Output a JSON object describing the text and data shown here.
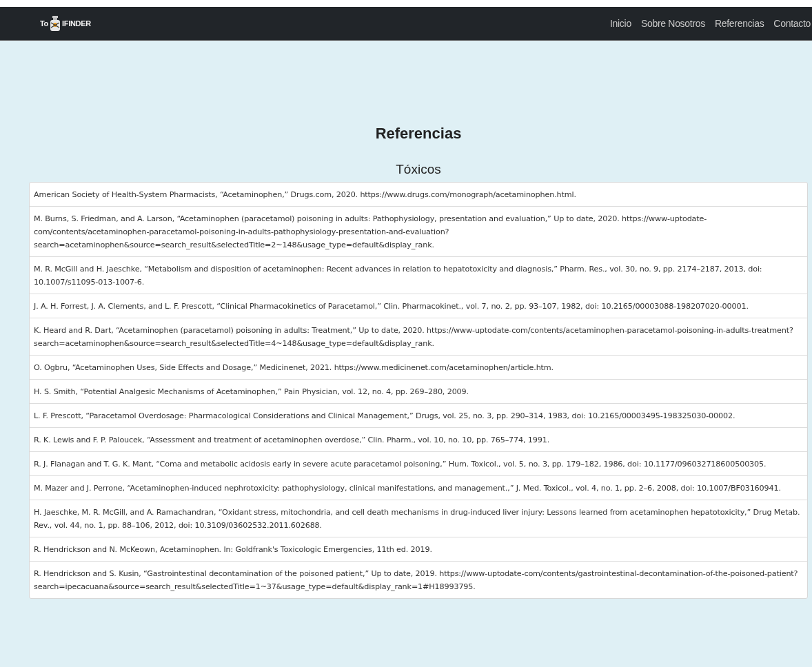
{
  "navbar": {
    "logo": {
      "prefix": "To",
      "suffix": "IFINDER"
    },
    "links": [
      {
        "label": "Inicio",
        "selected": false
      },
      {
        "label": "Sobre Nosotros",
        "selected": false
      },
      {
        "label": "Referencias",
        "selected": false
      },
      {
        "label": "Contacto",
        "selected": false
      }
    ]
  },
  "page_title": "Referencias",
  "section_title": "Tóxicos",
  "references": [
    "American Society of Health-System Pharmacists, “Acetaminophen,” Drugs.com, 2020. https://www.drugs.com/monograph/acetaminophen.html.",
    "M. Burns, S. Friedman, and A. Larson, “Acetaminophen (paracetamol) poisoning in adults: Pathophysiology, presentation and evaluation,” Up to date, 2020. https://www-uptodate-com/contents/acetaminophen-paracetamol-poisoning-in-adults-pathophysiology-presentation-and-evaluation?search=acetaminophen&source=search_result&selectedTitle=2~148&usage_type=default&display_rank.",
    "M. R. McGill and H. Jaeschke, “Metabolism and disposition of acetaminophen: Recent advances in relation to hepatotoxicity and diagnosis,” Pharm. Res., vol. 30, no. 9, pp. 2174–2187, 2013, doi: 10.1007/s11095-013-1007-6.",
    "J. A. H. Forrest, J. A. Clements, and L. F. Prescott, “Clinical Pharmacokinetics of Paracetamol,” Clin. Pharmacokinet., vol. 7, no. 2, pp. 93–107, 1982, doi: 10.2165/00003088-198207020-00001.",
    "K. Heard and R. Dart, “Acetaminophen (paracetamol) poisoning in adults: Treatment,” Up to date, 2020. https://www-uptodate-com/contents/acetaminophen-paracetamol-poisoning-in-adults-treatment?search=acetaminophen&source=search_result&selectedTitle=4~148&usage_type=default&display_rank.",
    "O. Ogbru, “Acetaminophen Uses, Side Effects and Dosage,” Medicinenet, 2021. https://www.medicinenet.com/acetaminophen/article.htm.",
    "H. S. Smith, “Potential Analgesic Mechanisms of Acetaminophen,” Pain Physician, vol. 12, no. 4, pp. 269–280, 2009.",
    "L. F. Prescott, “Paracetamol Overdosage: Pharmacological Considerations and Clinical Management,” Drugs, vol. 25, no. 3, pp. 290–314, 1983, doi: 10.2165/00003495-198325030-00002.",
    "R. K. Lewis and F. P. Paloucek, “Assessment and treatment of acetaminophen overdose,” Clin. Pharm., vol. 10, no. 10, pp. 765–774, 1991.",
    "R. J. Flanagan and T. G. K. Mant, “Coma and metabolic acidosis early in severe acute paracetamol poisoning,” Hum. Toxicol., vol. 5, no. 3, pp. 179–182, 1986, doi: 10.1177/096032718600500305.",
    "M. Mazer and J. Perrone, “Acetaminophen-induced nephrotoxicity: pathophysiology, clinical manifestations, and management.,” J. Med. Toxicol., vol. 4, no. 1, pp. 2–6, 2008, doi: 10.1007/BF03160941.",
    "H. Jaeschke, M. R. McGill, and A. Ramachandran, “Oxidant stress, mitochondria, and cell death mechanisms in drug-induced liver injury: Lessons learned from acetaminophen hepatotoxicity,” Drug Metab. Rev., vol. 44, no. 1, pp. 88–106, 2012, doi: 10.3109/03602532.2011.602688.",
    "R. Hendrickson and N. McKeown, Acetaminophen. In: Goldfrank's Toxicologic Emergencies, 11th ed. 2019.",
    "R. Hendrickson and S. Kusin, “Gastrointestinal decontamination of the poisoned patient,” Up to date, 2019. https://www-uptodate-com/contents/gastrointestinal-decontamination-of-the-poisoned-patient?search=ipecacuana&source=search_result&selectedTitle=1~37&usage_type=default&display_rank=1#H18993795."
  ]
}
